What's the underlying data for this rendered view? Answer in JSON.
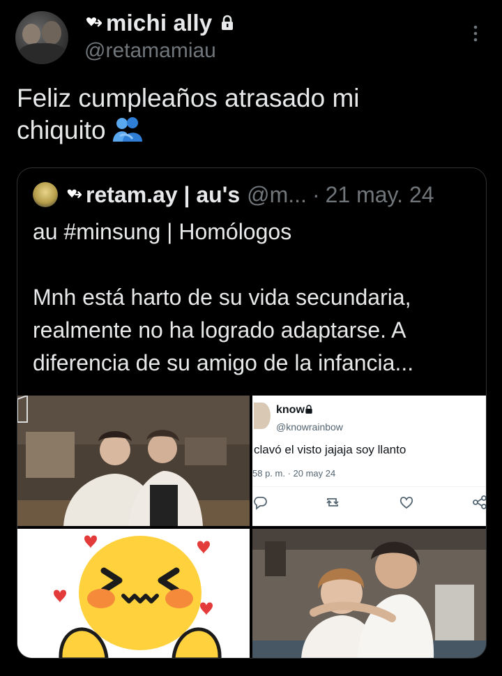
{
  "author": {
    "display_name": "michi ally",
    "handle": "@retamamiau",
    "protected": true
  },
  "tweet": {
    "text_line1": "Feliz cumpleaños atrasado mi",
    "text_line2": "chiquito",
    "emoji": "people-hugging-icon"
  },
  "quote": {
    "display_name": "retam.ay | au's",
    "handle": "@m...",
    "separator": "·",
    "date": "21 may. 24",
    "lines": [
      "au #minsung | Homólogos",
      "",
      "Mnh está harto de su vida secundaria,",
      "realmente no ha logrado adaptarse. A",
      "diferencia de su amigo de la infancia..."
    ],
    "media": {
      "embedded_tweet": {
        "display_name": "know",
        "handle": "@knowrainbow",
        "text": "clavó el visto jajaja soy llanto",
        "meta": "58 p. m. · 20 may 24"
      }
    }
  },
  "colors": {
    "background": "#000000",
    "text_primary": "#e7e9ea",
    "text_secondary": "#71767b",
    "border": "#2f3336",
    "emoji_blue": "#3b8ee8"
  }
}
